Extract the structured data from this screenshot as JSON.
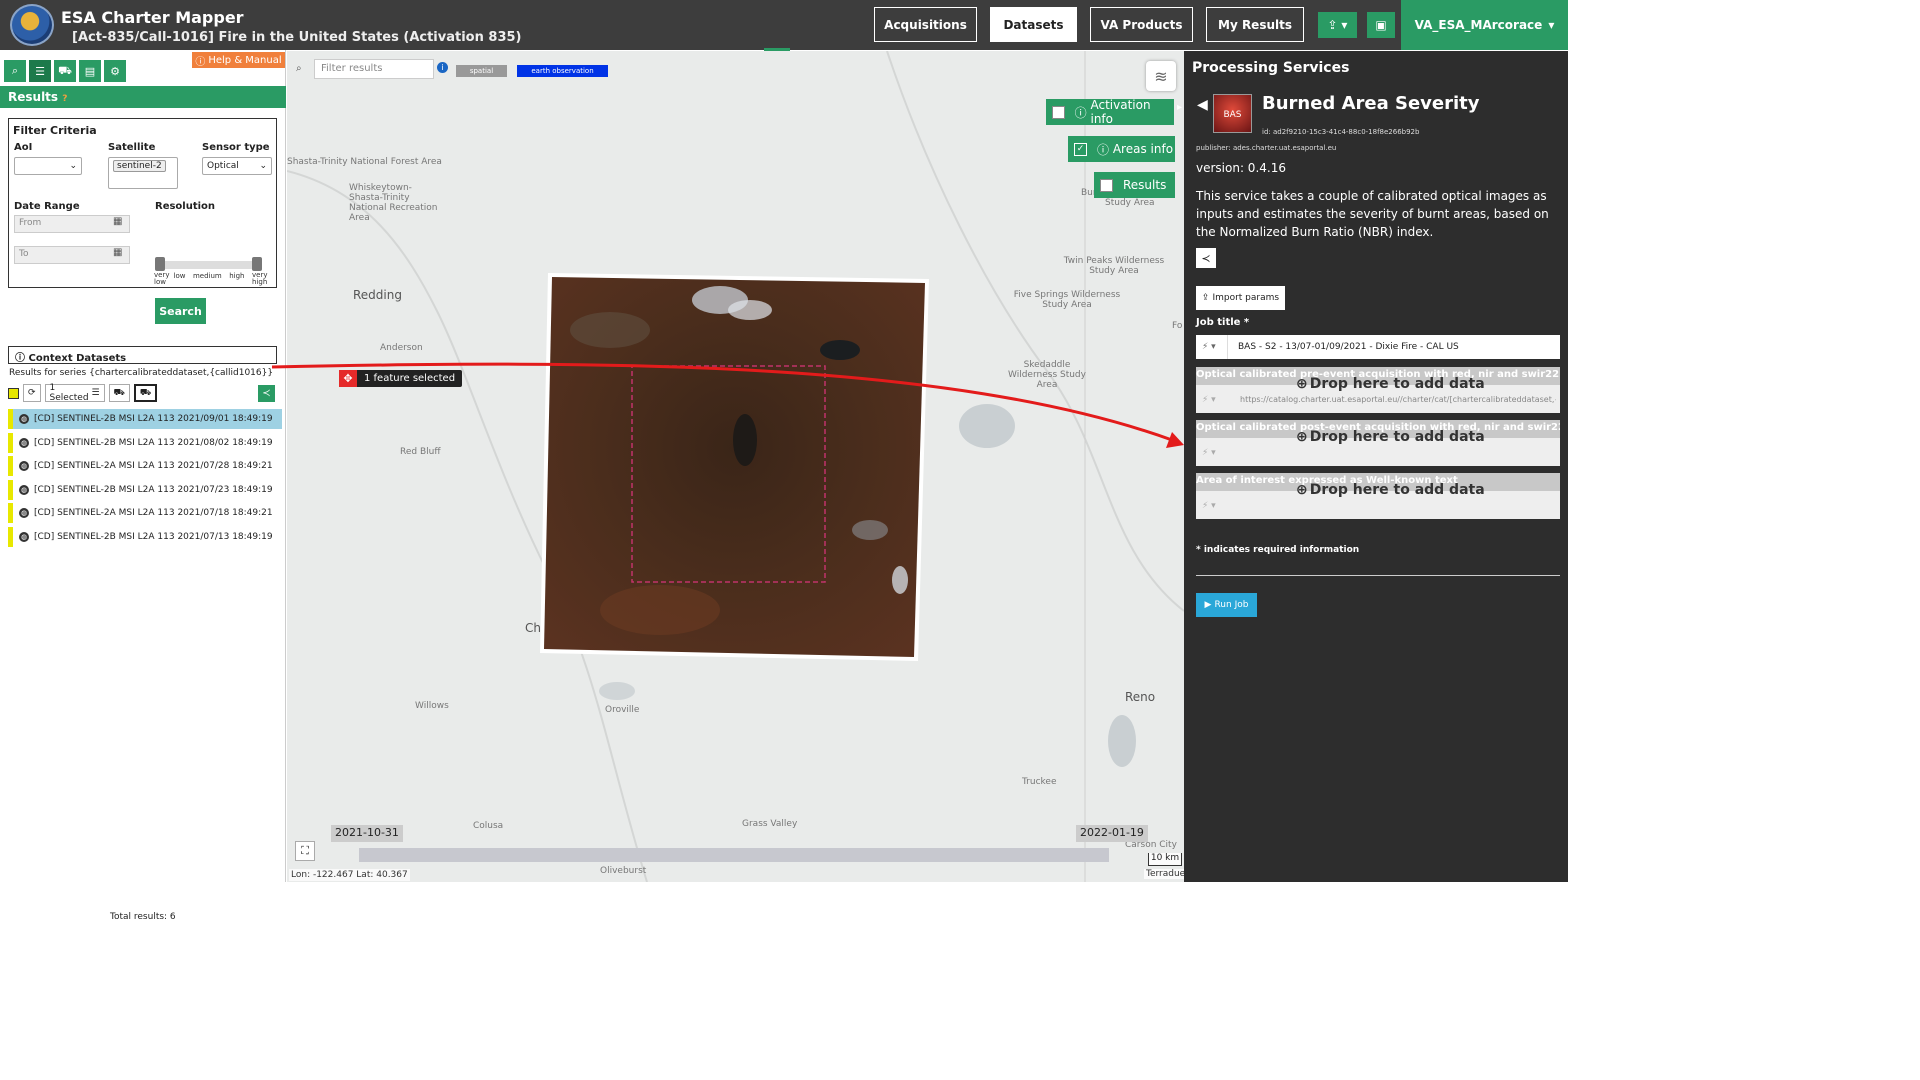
{
  "header": {
    "app_title": "ESA Charter Mapper",
    "activation": "[Act-835/Call-1016] Fire in the United States (Activation 835)",
    "nav": [
      "Acquisitions",
      "Datasets",
      "VA Products",
      "My Results"
    ],
    "user": "VA_ESA_MArcorace"
  },
  "left": {
    "help": "Help & Manual",
    "results_title": "Results",
    "filter_title": "Filter Criteria",
    "aoi_label": "AoI",
    "satellite_label": "Satellite",
    "satellite_chip": "sentinel-2",
    "sensor_label": "Sensor type",
    "sensor_value": "Optical",
    "date_range_label": "Date Range",
    "from_placeholder": "From",
    "to_placeholder": "To",
    "resolution_label": "Resolution",
    "resolution_levels": [
      "very low",
      "low",
      "medium",
      "high",
      "very high"
    ],
    "search": "Search",
    "context_title": "Context Datasets",
    "series": "Results for series {chartercalibrateddataset,{callid1016}}",
    "selected": "1 Selected",
    "rows": [
      "[CD] SENTINEL-2B MSI L2A 113 2021/09/01 18:49:19",
      "[CD] SENTINEL-2B MSI L2A 113 2021/08/02 18:49:19",
      "[CD] SENTINEL-2A MSI L2A 113 2021/07/28 18:49:21",
      "[CD] SENTINEL-2B MSI L2A 113 2021/07/23 18:49:19",
      "[CD] SENTINEL-2A MSI L2A 113 2021/07/18 18:49:21",
      "[CD] SENTINEL-2B MSI L2A 113 2021/07/13 18:49:19"
    ],
    "total": "Total results: 6"
  },
  "map": {
    "filter_placeholder": "Filter results",
    "tag_spatial": "spatial",
    "tag_eo": "earth observation",
    "activation_info": "Activation info",
    "areas_info": "Areas info",
    "results": "Results",
    "feature_selected": "1 feature selected",
    "date_start": "2021-10-31",
    "date_end": "2022-01-19",
    "coords": "Lon: -122.467 Lat: 40.367",
    "scale": "10 km",
    "attribution": "Terradue",
    "places": [
      "Shasta-Trinity National Forest Area",
      "Whiskeytown-Shasta-Trinity National Recreation Area",
      "Redding",
      "Anderson",
      "Red Bluff",
      "Ch",
      "Willows",
      "Oroville",
      "Colusa",
      "Grass Valley",
      "Oliveburst",
      "Reno",
      "Carson City",
      "Truckee",
      "Twin Peaks Wilderness Study Area",
      "Five Springs Wilderness Study Area",
      "Skedaddle Wilderness Study Area",
      "Study Area",
      "Bur",
      "Fo"
    ]
  },
  "processing": {
    "title": "Processing Services",
    "service_name": "Burned Area Severity",
    "icon_text": "BAS",
    "id": "id: ad2f9210-15c3-41c4-88c0-18f8e266b92b",
    "publisher": "publisher: ades.charter.uat.esaportal.eu",
    "version": "version: 0.4.16",
    "description": "This service takes a couple of calibrated optical images as inputs and estimates the severity of burnt areas, based on the Normalized Burn Ratio (NBR) index.",
    "import_params": "Import params",
    "job_title_label": "Job title *",
    "job_title_value": "BAS - S2 - 13/07-01/09/2021 - Dixie Fire - CAL US",
    "pre_label": "Optical calibrated pre-event acquisition with red, nir and swir22 *",
    "pre_url": "https://catalog.charter.uat.esaportal.eu//charter/cat/[chartercalibrateddataset,{ca",
    "post_label": "Optical calibrated post-event acquisition with red, nir and swir22 *",
    "aoi_label": "Area of interest expressed as Well-known text",
    "drop_text": "Drop here to add data",
    "required_note": "* indicates required information",
    "run_job": "Run Job"
  }
}
